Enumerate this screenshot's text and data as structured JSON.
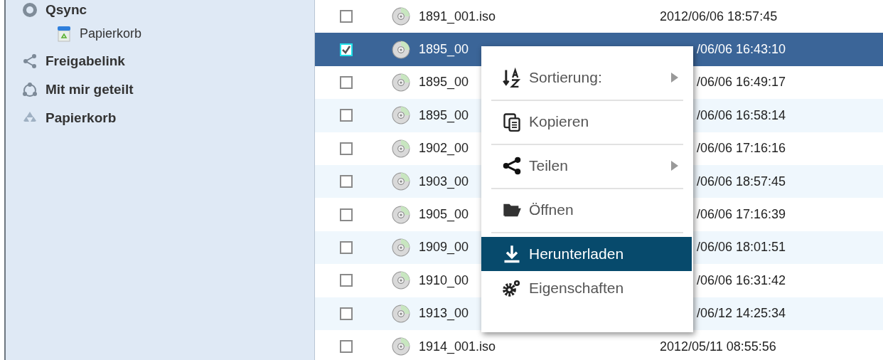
{
  "sidebar": {
    "items": [
      {
        "label": "Qsync",
        "children": [
          {
            "label": "Papierkorb"
          }
        ]
      },
      {
        "label": "Freigabelink"
      },
      {
        "label": "Mit mir geteilt"
      },
      {
        "label": "Papierkorb"
      }
    ]
  },
  "files": {
    "rows": [
      {
        "name": "1891_001.iso",
        "modified": "2012/06/06 18:57:45",
        "checked": false,
        "selected": false
      },
      {
        "name": "1895_00",
        "modified": "/06/06 16:43:10",
        "checked": true,
        "selected": true
      },
      {
        "name": "1895_00",
        "modified": "/06/06 16:49:17",
        "checked": false,
        "selected": false
      },
      {
        "name": "1895_00",
        "modified": "/06/06 16:58:14",
        "checked": false,
        "selected": false
      },
      {
        "name": "1902_00",
        "modified": "/06/06 17:16:16",
        "checked": false,
        "selected": false
      },
      {
        "name": "1903_00",
        "modified": "/06/06 18:57:45",
        "checked": false,
        "selected": false
      },
      {
        "name": "1905_00",
        "modified": "/06/06 17:16:39",
        "checked": false,
        "selected": false
      },
      {
        "name": "1909_00",
        "modified": "/06/06 18:01:51",
        "checked": false,
        "selected": false
      },
      {
        "name": "1910_00",
        "modified": "/06/06 16:31:42",
        "checked": false,
        "selected": false
      },
      {
        "name": "1913_00",
        "modified": "/06/12 14:25:34",
        "checked": false,
        "selected": false
      },
      {
        "name": "1914_001.iso",
        "modified": "2012/05/11 08:55:56",
        "checked": false,
        "selected": false
      }
    ]
  },
  "context_menu": {
    "items": [
      {
        "label": "Sortierung:",
        "submenu": true,
        "separator_after": true,
        "selected": false
      },
      {
        "label": "Kopieren",
        "submenu": false,
        "separator_after": true,
        "selected": false
      },
      {
        "label": "Teilen",
        "submenu": true,
        "separator_after": true,
        "selected": false
      },
      {
        "label": "Öffnen",
        "submenu": false,
        "separator_after": true,
        "selected": false
      },
      {
        "label": "Herunterladen",
        "submenu": false,
        "separator_after": false,
        "selected": true
      },
      {
        "label": "Eigenschaften",
        "submenu": false,
        "separator_after": false,
        "selected": false
      }
    ]
  }
}
